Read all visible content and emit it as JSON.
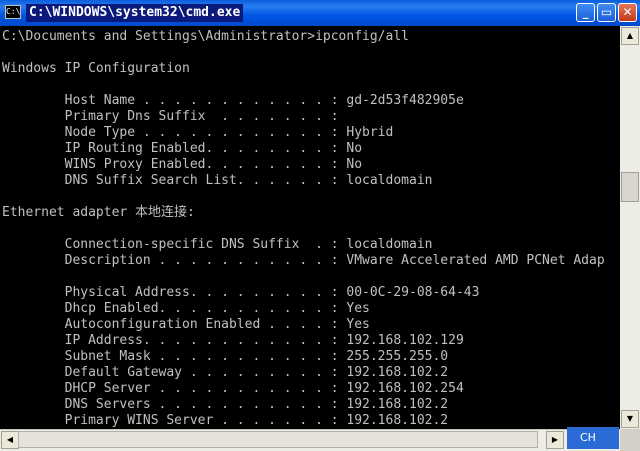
{
  "window": {
    "title": "C:\\WINDOWS\\system32\\cmd.exe",
    "icon_text": "C:\\",
    "minimize_glyph": "_",
    "maximize_glyph": "▭",
    "close_glyph": "✕"
  },
  "console": {
    "lines": [
      "C:\\Documents and Settings\\Administrator>ipconfig/all",
      "",
      "Windows IP Configuration",
      "",
      "        Host Name . . . . . . . . . . . . : gd-2d53f482905e",
      "        Primary Dns Suffix  . . . . . . . :",
      "        Node Type . . . . . . . . . . . . : Hybrid",
      "        IP Routing Enabled. . . . . . . . : No",
      "        WINS Proxy Enabled. . . . . . . . : No",
      "        DNS Suffix Search List. . . . . . : localdomain",
      "",
      "Ethernet adapter 本地连接:",
      "",
      "        Connection-specific DNS Suffix  . : localdomain",
      "        Description . . . . . . . . . . . : VMware Accelerated AMD PCNet Adap",
      "",
      "        Physical Address. . . . . . . . . : 00-0C-29-08-64-43",
      "        Dhcp Enabled. . . . . . . . . . . : Yes",
      "        Autoconfiguration Enabled . . . . : Yes",
      "        IP Address. . . . . . . . . . . . : 192.168.102.129",
      "        Subnet Mask . . . . . . . . . . . : 255.255.255.0",
      "        Default Gateway . . . . . . . . . : 192.168.102.2",
      "        DHCP Server . . . . . . . . . . . : 192.168.102.254",
      "        DNS Servers . . . . . . . . . . . : 192.168.102.2",
      "        Primary WINS Server . . . . . . . : 192.168.102.2"
    ]
  },
  "scrollbar": {
    "up_arrow": "▲",
    "down_arrow": "▼",
    "left_arrow": "◀",
    "right_arrow": "▶"
  },
  "ime": {
    "label": "CH",
    "dropdown": "▼"
  },
  "colors": {
    "console_bg": "#000000",
    "console_text": "#c0c0c0",
    "titlebar": "#0055e5"
  }
}
